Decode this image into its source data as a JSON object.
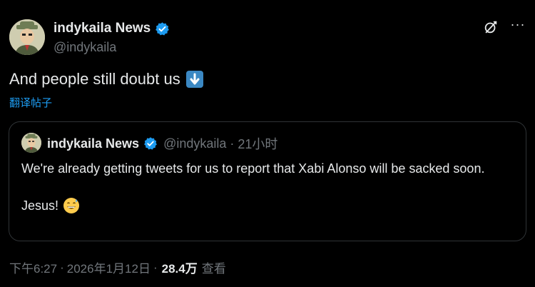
{
  "author": {
    "display_name": "indykaila News",
    "handle": "@indykaila"
  },
  "tweet": {
    "text": "And people still doubt us",
    "emoji": "down-arrow-emoji",
    "translate_label": "翻译帖子"
  },
  "quoted": {
    "display_name": "indykaila News",
    "handle": "@indykaila",
    "separator": "·",
    "time": "21小时",
    "line1": "We're already getting tweets for us to report that Xabi Alonso will be sacked soon.",
    "line2": "Jesus!"
  },
  "meta": {
    "time": "下午6:27",
    "separator1": "·",
    "date": "2026年1月12日",
    "separator2": "·",
    "views": "28.4万",
    "views_label": "查看"
  },
  "colors": {
    "background": "#000000",
    "text": "#e7e9ea",
    "muted": "#71767b",
    "link": "#1d9bf0",
    "border": "#2f3336"
  },
  "icons": {
    "top_right": [
      "grok-icon",
      "more-icon"
    ],
    "verified": "verified-badge-icon"
  }
}
